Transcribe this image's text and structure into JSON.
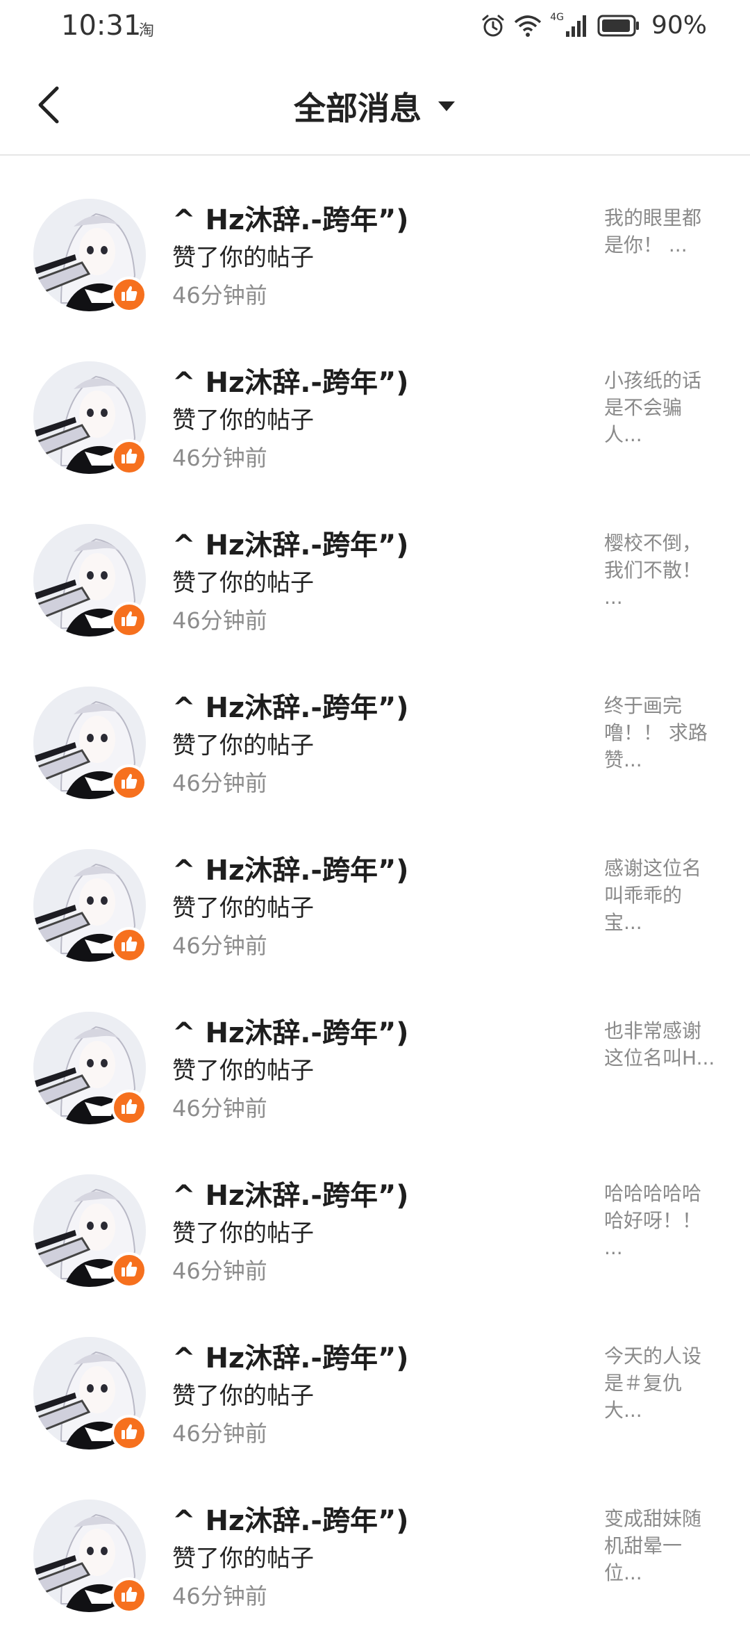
{
  "status_bar": {
    "time": "10:31",
    "app_icon": "淘",
    "network": "4G",
    "battery": "90%"
  },
  "header": {
    "title": "全部消息"
  },
  "messages": [
    {
      "name": "^ Hz沐辞.-跨年”)",
      "action": "赞了你的帖子",
      "time": "46分钟前",
      "preview": "我的眼里都是你！ ..."
    },
    {
      "name": "^ Hz沐辞.-跨年”)",
      "action": "赞了你的帖子",
      "time": "46分钟前",
      "preview": "小孩纸的话是不会骗人..."
    },
    {
      "name": "^ Hz沐辞.-跨年”)",
      "action": "赞了你的帖子",
      "time": "46分钟前",
      "preview": "樱校不倒，我们不散！ ..."
    },
    {
      "name": "^ Hz沐辞.-跨年”)",
      "action": "赞了你的帖子",
      "time": "46分钟前",
      "preview": "终于画完噜！！ 求路赞..."
    },
    {
      "name": "^ Hz沐辞.-跨年”)",
      "action": "赞了你的帖子",
      "time": "46分钟前",
      "preview": "感谢这位名叫乖乖的宝..."
    },
    {
      "name": "^ Hz沐辞.-跨年”)",
      "action": "赞了你的帖子",
      "time": "46分钟前",
      "preview": "也非常感谢这位名叫H..."
    },
    {
      "name": "^ Hz沐辞.-跨年”)",
      "action": "赞了你的帖子",
      "time": "46分钟前",
      "preview": "哈哈哈哈哈哈好呀！！ ..."
    },
    {
      "name": "^ Hz沐辞.-跨年”)",
      "action": "赞了你的帖子",
      "time": "46分钟前",
      "preview": "今天的人设是＃复仇大..."
    },
    {
      "name": "^ Hz沐辞.-跨年”)",
      "action": "赞了你的帖子",
      "time": "46分钟前",
      "preview": "变成甜妹随机甜晕一位..."
    }
  ],
  "colors": {
    "like_badge": "#f6701e",
    "secondary_text": "#8c8c8c"
  },
  "icons": {
    "back": "back-arrow-icon",
    "dropdown": "caret-down-icon",
    "like": "thumbs-up-icon"
  }
}
